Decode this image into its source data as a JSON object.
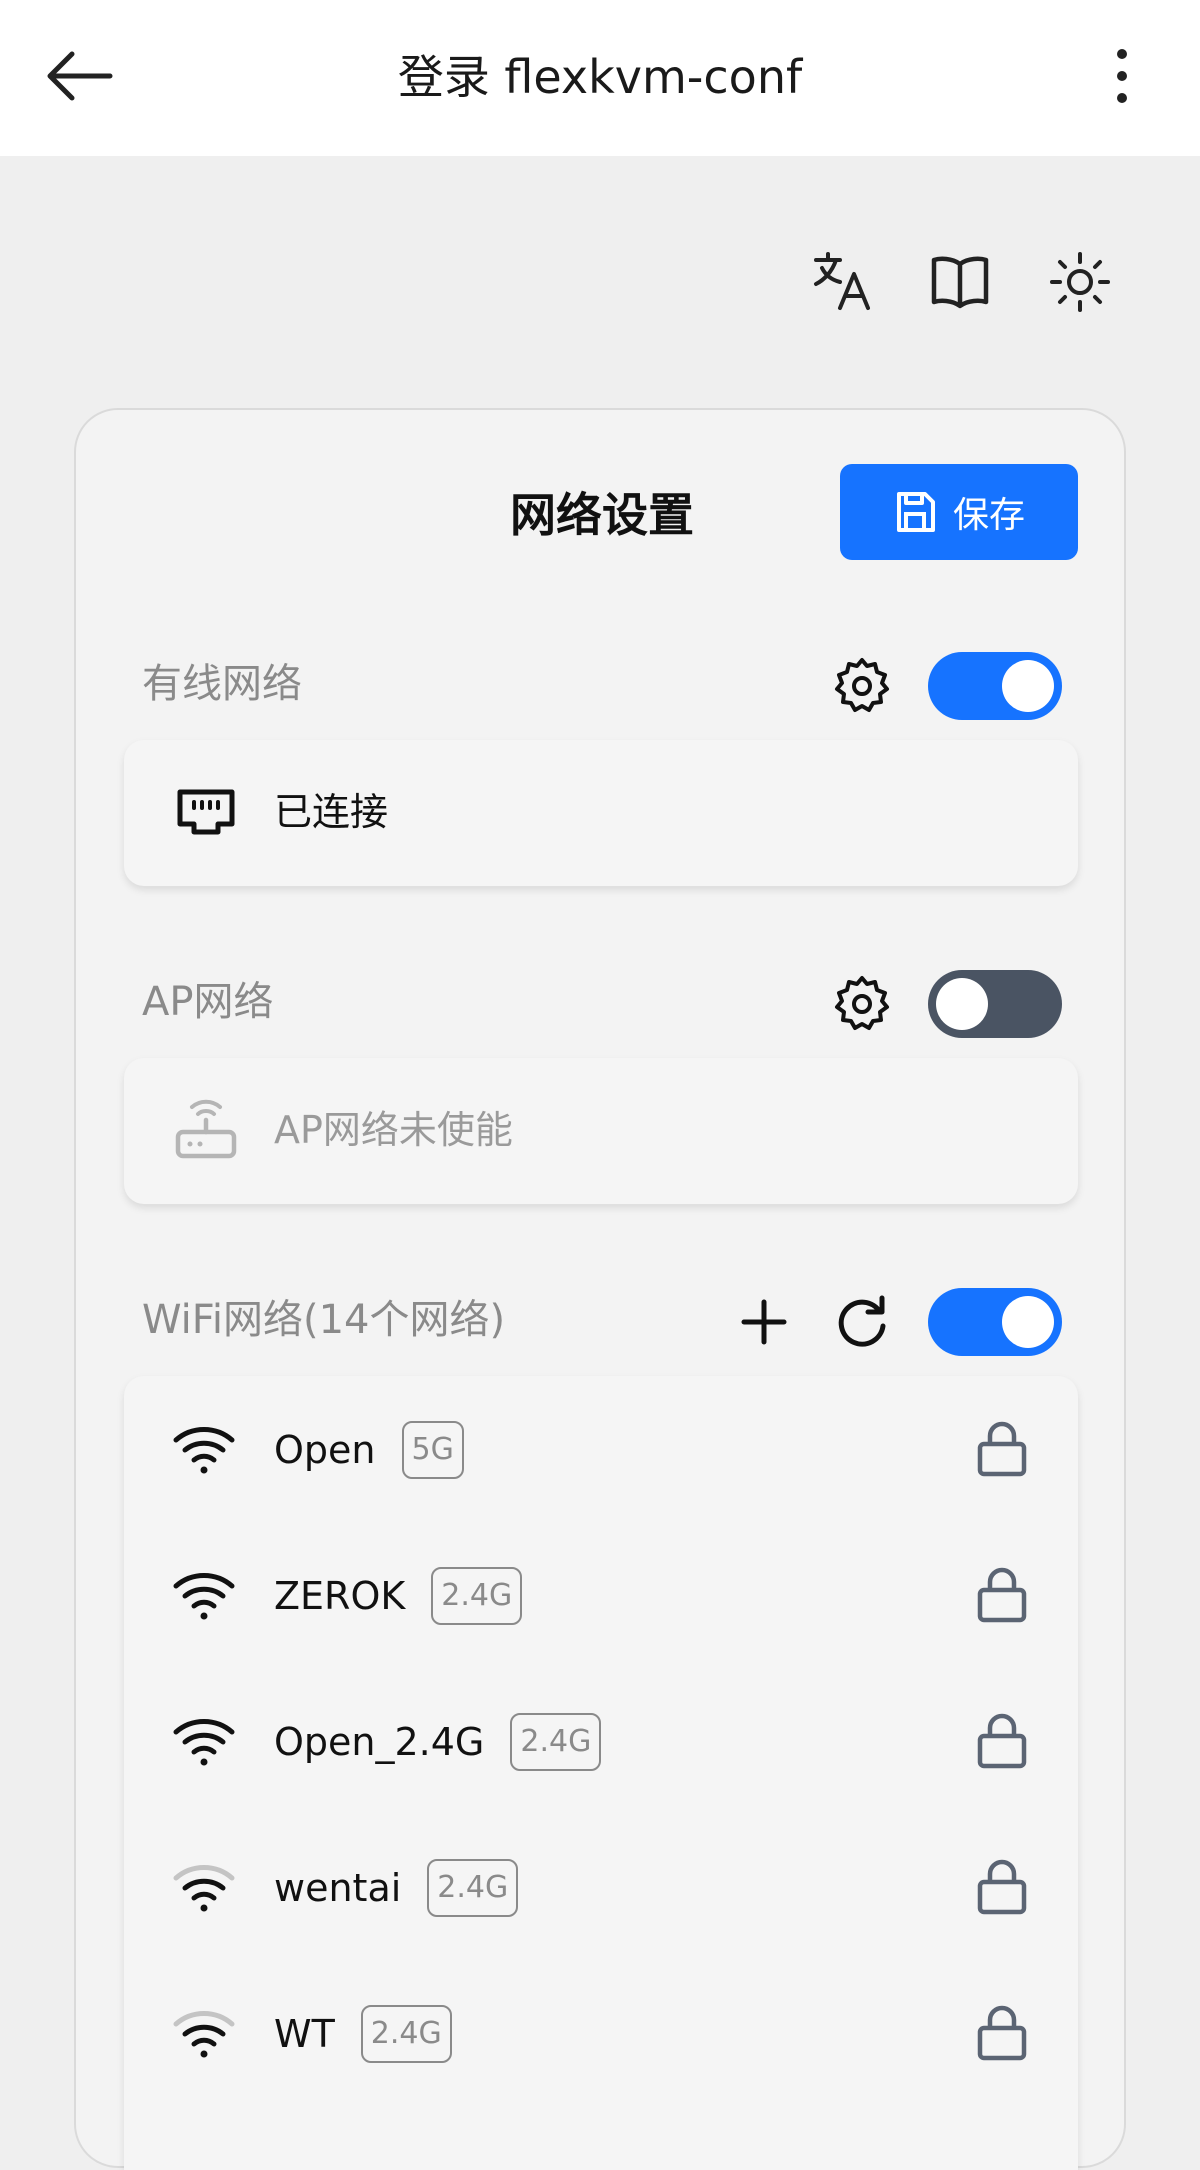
{
  "header": {
    "title": "登录 flexkvm-conf"
  },
  "toolbar_icons": [
    "translate-icon",
    "book-icon",
    "sun-icon"
  ],
  "card": {
    "title": "网络设置",
    "save_label": "保存",
    "accent_color": "#1673ff"
  },
  "wired": {
    "label": "有线网络",
    "enabled": true,
    "status": "已连接"
  },
  "ap": {
    "label": "AP网络",
    "enabled": false,
    "status": "AP网络未使能"
  },
  "wifi": {
    "label": "WiFi网络(14个网络)",
    "enabled": true,
    "networks": [
      {
        "ssid": "Open",
        "band": "5G",
        "signal": "strong",
        "locked": true
      },
      {
        "ssid": "ZEROK",
        "band": "2.4G",
        "signal": "strong",
        "locked": true
      },
      {
        "ssid": "Open_2.4G",
        "band": "2.4G",
        "signal": "strong",
        "locked": true
      },
      {
        "ssid": "wentai",
        "band": "2.4G",
        "signal": "medium",
        "locked": true
      },
      {
        "ssid": "WT",
        "band": "2.4G",
        "signal": "medium",
        "locked": true
      }
    ]
  }
}
